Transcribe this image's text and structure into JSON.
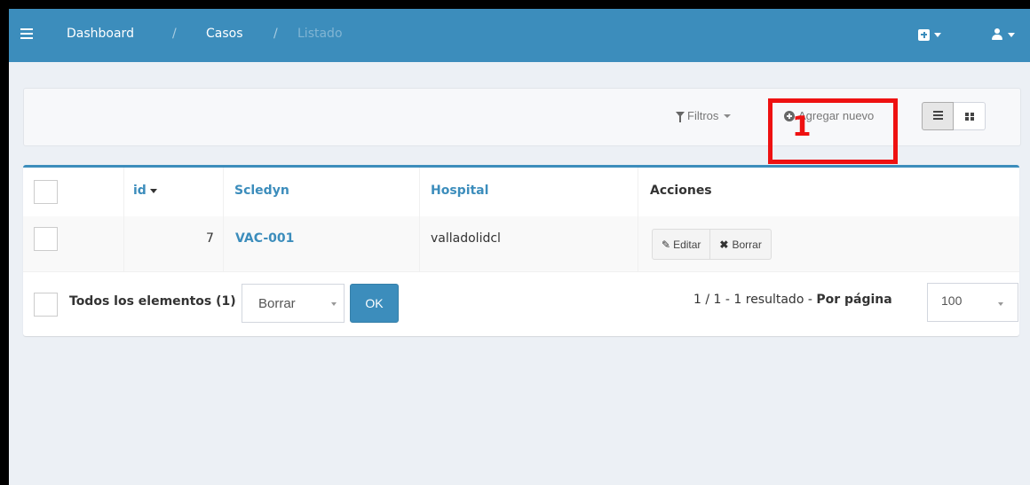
{
  "navbar": {
    "breadcrumb": [
      "Dashboard",
      "Casos",
      "Listado"
    ],
    "separator": "/"
  },
  "toolbar": {
    "filters_label": "Filtros",
    "add_new_label": "Agregar nuevo",
    "annotation_number": "1"
  },
  "table": {
    "columns": [
      "id",
      "Scledyn",
      "Hospital",
      "Acciones"
    ],
    "rows": [
      {
        "id": "7",
        "scledyn": "VAC-001",
        "hospital": "valladolidcl",
        "edit_label": "Editar",
        "delete_label": "Borrar"
      }
    ]
  },
  "footer": {
    "all_elements_label": "Todos los elementos (1)",
    "batch_action_value": "Borrar",
    "ok_label": "OK",
    "pagination_text": "1 / 1 - 1 resultado -",
    "per_page_label": "Por página",
    "per_page_value": "100"
  },
  "colors": {
    "primary": "#3c8dbc",
    "annotation": "#ee1111"
  }
}
